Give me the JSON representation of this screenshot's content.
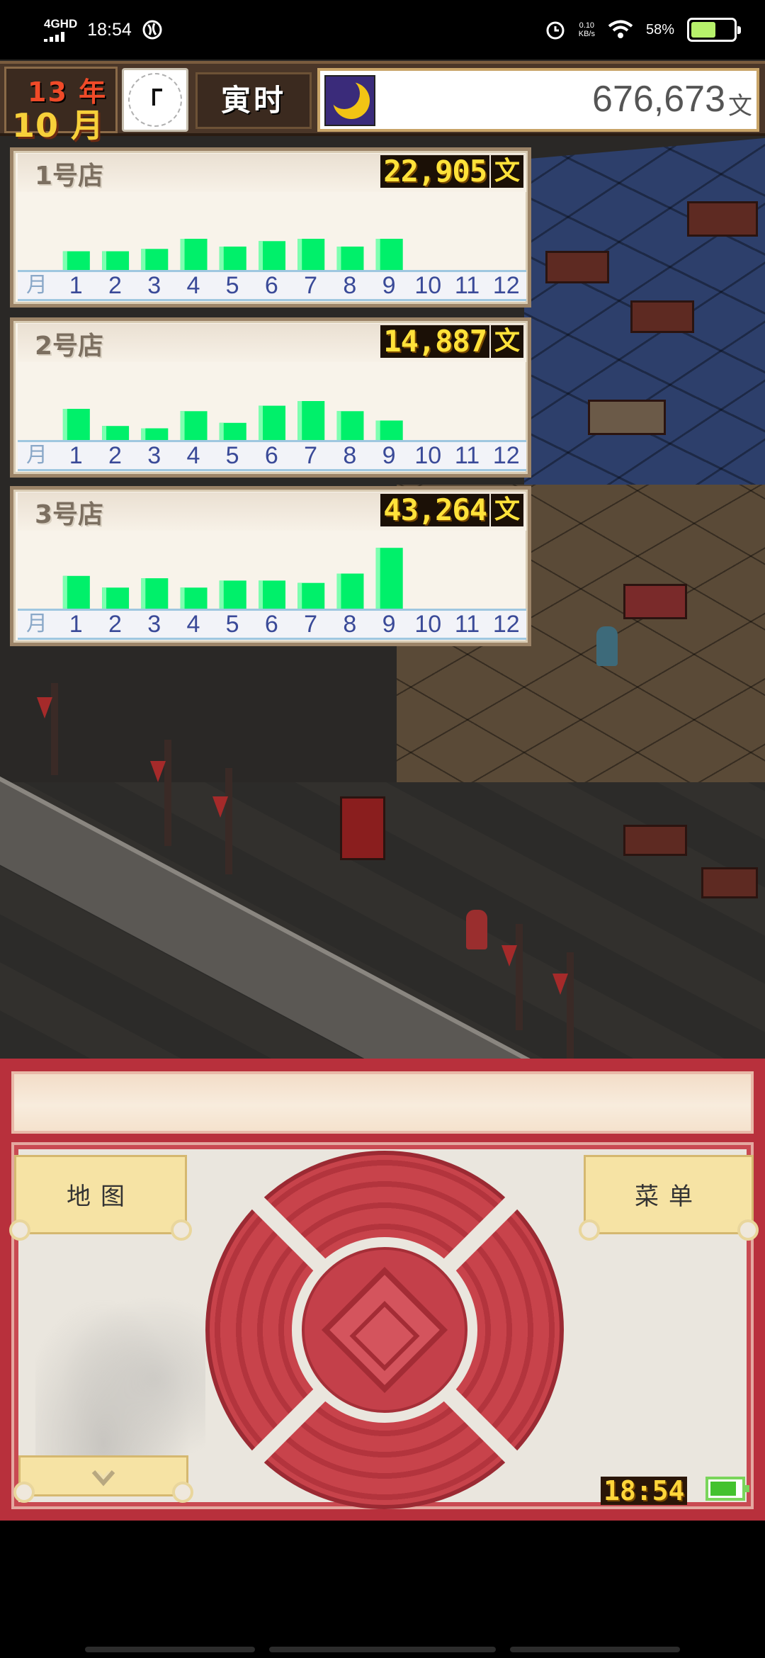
{
  "status_bar": {
    "network": "4GHD",
    "time": "18:54",
    "net_speed_value": "0.10",
    "net_speed_unit": "KB/s",
    "battery_percent": "58%",
    "battery_level": 0.58
  },
  "hud": {
    "year_label": "13 年",
    "month_label": "10 月",
    "period": "寅时",
    "money": "676,673",
    "money_unit": "文"
  },
  "stores": [
    {
      "name": "1号店",
      "total": "22,905",
      "unit": "文"
    },
    {
      "name": "2号店",
      "total": "14,887",
      "unit": "文"
    },
    {
      "name": "3号店",
      "total": "43,264",
      "unit": "文"
    }
  ],
  "months": {
    "label": "月",
    "items": [
      "1",
      "2",
      "3",
      "4",
      "5",
      "6",
      "7",
      "8",
      "9",
      "10",
      "11",
      "12"
    ]
  },
  "chart_data": [
    {
      "type": "bar",
      "categories": [
        "1",
        "2",
        "3",
        "4",
        "5",
        "6",
        "7",
        "8",
        "9",
        "10",
        "11",
        "12"
      ],
      "values": [
        24,
        24,
        27,
        40,
        30,
        37,
        40,
        30,
        40,
        0,
        0,
        0
      ],
      "ylim": [
        0,
        100
      ],
      "bar_color": "#00f06a"
    },
    {
      "type": "bar",
      "categories": [
        "1",
        "2",
        "3",
        "4",
        "5",
        "6",
        "7",
        "8",
        "9",
        "10",
        "11",
        "12"
      ],
      "values": [
        40,
        18,
        15,
        37,
        22,
        44,
        50,
        37,
        25,
        0,
        0,
        0
      ],
      "ylim": [
        0,
        100
      ],
      "bar_color": "#00f06a"
    },
    {
      "type": "bar",
      "categories": [
        "1",
        "2",
        "3",
        "4",
        "5",
        "6",
        "7",
        "8",
        "9",
        "10",
        "11",
        "12"
      ],
      "values": [
        42,
        27,
        39,
        27,
        36,
        36,
        33,
        45,
        78,
        0,
        0,
        0
      ],
      "ylim": [
        0,
        100
      ],
      "bar_color": "#00f06a"
    }
  ],
  "controls": {
    "map_label": "地图",
    "menu_label": "菜单",
    "collapse_icon": "chevron-down-icon",
    "game_time": "18:54"
  },
  "colors": {
    "bar": "#00f06a",
    "accent_red": "#b8303c",
    "gold": "#ffe23a"
  }
}
